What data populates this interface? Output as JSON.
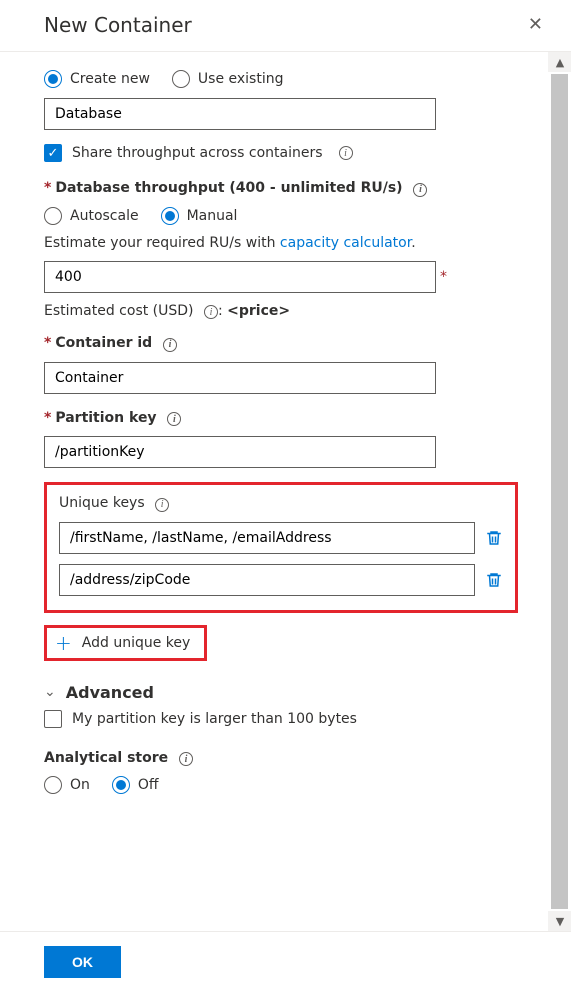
{
  "header": {
    "title": "New Container"
  },
  "databaseMode": {
    "createNew": {
      "label": "Create new",
      "selected": true
    },
    "useExisting": {
      "label": "Use existing",
      "selected": false
    }
  },
  "databaseName": {
    "value": "Database"
  },
  "shareThroughput": {
    "label": "Share throughput across containers",
    "checked": true
  },
  "throughputSection": {
    "label": "Database throughput (400 - unlimited RU/s)",
    "autoscale": {
      "label": "Autoscale",
      "selected": false
    },
    "manual": {
      "label": "Manual",
      "selected": true
    },
    "hintPrefix": "Estimate your required RU/s with ",
    "hintLink": "capacity calculator",
    "hintSuffix": ".",
    "value": "400",
    "costLabel": "Estimated cost (USD)",
    "costValue": "<price>"
  },
  "containerId": {
    "label": "Container id",
    "value": "Container"
  },
  "partitionKey": {
    "label": "Partition key",
    "value": "/partitionKey"
  },
  "uniqueKeys": {
    "label": "Unique keys",
    "rows": [
      {
        "value": "/firstName, /lastName, /emailAddress"
      },
      {
        "value": "/address/zipCode"
      }
    ],
    "addLabel": "Add unique key"
  },
  "advanced": {
    "label": "Advanced",
    "largePk": {
      "label": "My partition key is larger than 100 bytes",
      "checked": false
    }
  },
  "analytical": {
    "label": "Analytical store",
    "on": {
      "label": "On",
      "selected": false
    },
    "off": {
      "label": "Off",
      "selected": true
    }
  },
  "footer": {
    "ok": "OK"
  }
}
